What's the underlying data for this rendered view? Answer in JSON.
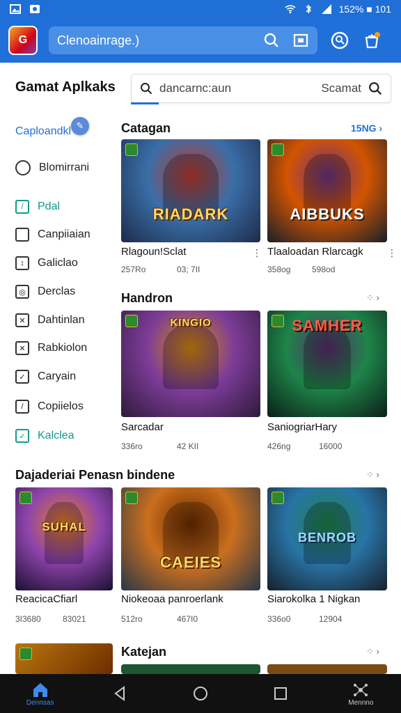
{
  "status_bar": {
    "right_text": "152% ■ 101"
  },
  "app_bar": {
    "search_text": "Clenoainrage.)"
  },
  "page": {
    "title": "Gamat Aplkaks",
    "search_query": "dancarnc:aun",
    "search_hint": "Scamat"
  },
  "sidebar": {
    "items": [
      {
        "label": "Caploandkl",
        "style": "blue"
      },
      {
        "label": "Blomirrani",
        "style": "normal"
      },
      {
        "label": "Pdal",
        "style": "teal"
      },
      {
        "label": "Canpiiaian",
        "style": "normal"
      },
      {
        "label": "Galiclao",
        "style": "normal"
      },
      {
        "label": "Derclas",
        "style": "normal"
      },
      {
        "label": "Dahtinlan",
        "style": "normal"
      },
      {
        "label": "Rabkiolon",
        "style": "normal"
      },
      {
        "label": "Caryain",
        "style": "normal"
      },
      {
        "label": "Copiielos",
        "style": "normal"
      },
      {
        "label": "Kalclea",
        "style": "teal"
      }
    ]
  },
  "sections": [
    {
      "title": "Catagan",
      "more_label": "15NG",
      "cards": [
        {
          "name": "Rlagoun!Sclat",
          "meta1": "257Ro",
          "meta2": "03; 7II",
          "logo": "RIADARK",
          "colors": [
            "#3a6ea8",
            "#c0392b",
            "#1d2b4a"
          ]
        },
        {
          "name": "Tlaaloadan Rlarcagk",
          "meta1": "358og",
          "meta2": "598od",
          "logo": "AIBBUKS",
          "colors": [
            "#d35400",
            "#6c3483",
            "#17202a"
          ]
        }
      ]
    },
    {
      "title": "Handron",
      "more_label": "",
      "cards": [
        {
          "name": "Sarcadar",
          "meta1": "336ro",
          "meta2": "42 KII",
          "logo": "KINGIO",
          "colors": [
            "#7d3c98",
            "#d68910",
            "#2e1a3a"
          ]
        },
        {
          "name": "SaniogriarHary",
          "meta1": "426ng",
          "meta2": "16000",
          "logo": "SAMHER",
          "colors": [
            "#1e8449",
            "#5b2c6f",
            "#0b1f17"
          ]
        }
      ]
    },
    {
      "title": "Dajaderiai Penasn bindene",
      "more_label": "",
      "cards": [
        {
          "name": "ReacicaCfiarl",
          "meta1": "3I3680",
          "meta2": "83021",
          "logo": "SUHAL",
          "colors": [
            "#8e44ad",
            "#e67e22",
            "#1b1030"
          ]
        },
        {
          "name": "Niokeoaa panroerlank",
          "meta1": "512ro",
          "meta2": "467I0",
          "logo": "CAEIES",
          "colors": [
            "#ca6f1e",
            "#6e2c00",
            "#283747"
          ]
        },
        {
          "name": "Siarokolka 1 Nigkan",
          "meta1": "336o0",
          "meta2": "12904",
          "logo": "BENROB",
          "colors": [
            "#2874a6",
            "#1e8449",
            "#17202a"
          ]
        }
      ]
    },
    {
      "title": "Katejan",
      "more_label": "",
      "cards": []
    }
  ],
  "nav_bar": {
    "home_label": "Dennsas",
    "menu_label": "Mennno"
  }
}
